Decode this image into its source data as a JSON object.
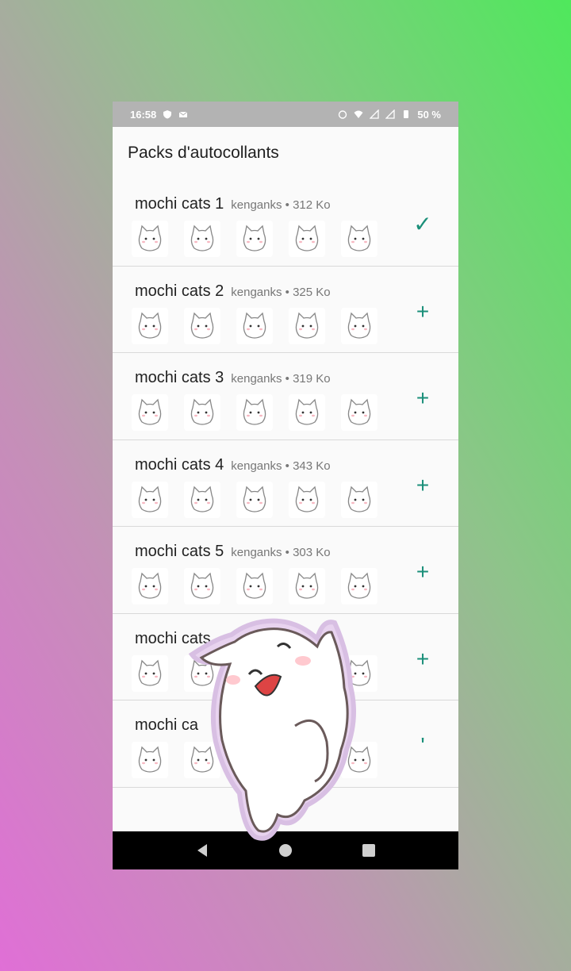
{
  "status": {
    "time": "16:58",
    "battery": "50 %"
  },
  "appbar": {
    "title": "Packs d'autocollants"
  },
  "packs": [
    {
      "name": "mochi cats 1",
      "meta": "kenganks • 312 Ko",
      "action": "✓",
      "action_icon": "check-icon"
    },
    {
      "name": "mochi cats 2",
      "meta": "kenganks • 325 Ko",
      "action": "+",
      "action_icon": "add-icon"
    },
    {
      "name": "mochi cats 3",
      "meta": "kenganks • 319 Ko",
      "action": "+",
      "action_icon": "add-icon"
    },
    {
      "name": "mochi cats 4",
      "meta": "kenganks • 343 Ko",
      "action": "+",
      "action_icon": "add-icon"
    },
    {
      "name": "mochi cats 5",
      "meta": "kenganks • 303 Ko",
      "action": "+",
      "action_icon": "add-icon"
    },
    {
      "name": "mochi cats",
      "meta": "",
      "action": "+",
      "action_icon": "add-icon"
    },
    {
      "name": "mochi ca",
      "meta": "",
      "action": "'",
      "action_icon": "add-icon"
    }
  ],
  "colors": {
    "accent": "#1a8f79",
    "statusbar": "#b3b3b3"
  }
}
